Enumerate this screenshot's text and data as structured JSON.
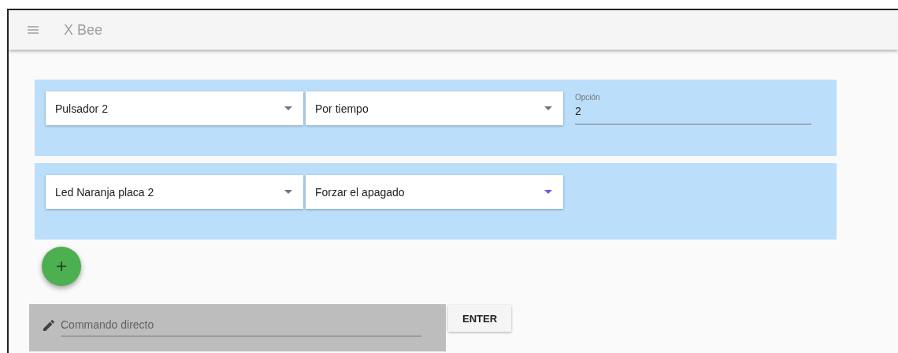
{
  "app_bar": {
    "title": "X Bee"
  },
  "rules": [
    {
      "device": {
        "value": "Pulsador 2",
        "focused": false
      },
      "action": {
        "value": "Por tiempo",
        "focused": false
      },
      "option": {
        "label": "Opción",
        "value": "2"
      }
    },
    {
      "device": {
        "value": "Led Naranja placa 2",
        "focused": false
      },
      "action": {
        "value": "Forzar el apagado",
        "focused": true
      }
    }
  ],
  "command": {
    "placeholder": "Commando directo",
    "button": "ENTER"
  }
}
